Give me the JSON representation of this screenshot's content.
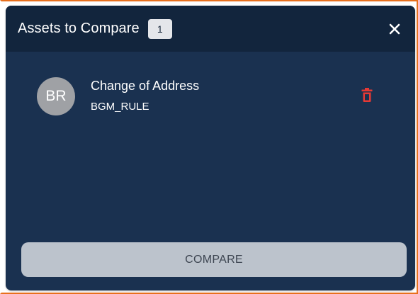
{
  "dialog": {
    "title": "Assets to Compare",
    "count": "1",
    "close_icon": "close-icon"
  },
  "assets": [
    {
      "avatar_initials": "BR",
      "name": "Change of Address",
      "type": "BGM_RULE",
      "delete_icon": "trash-icon"
    }
  ],
  "footer": {
    "compare_label": "COMPARE"
  },
  "colors": {
    "panel_bg": "#1a3150",
    "header_bg": "#12253d",
    "badge_bg": "#e4e6ea",
    "avatar_bg": "#9fa1a5",
    "delete_red": "#e53935",
    "button_bg": "#bcc3cc",
    "outline_orange": "#e8701d"
  }
}
